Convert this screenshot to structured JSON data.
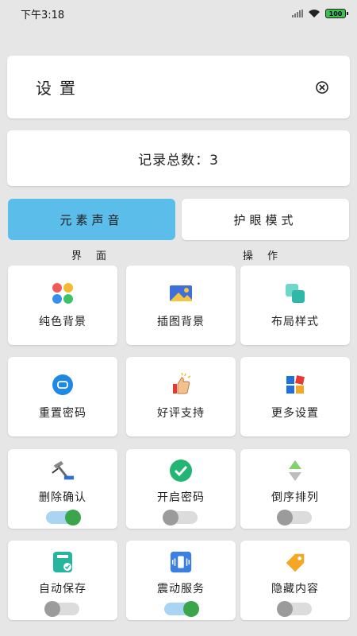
{
  "status": {
    "time": "下午3:18",
    "battery": "100"
  },
  "header": {
    "title": "设置",
    "close_icon": "close-circle-icon"
  },
  "summary": {
    "record_count_text": "记录总数：3"
  },
  "tabs": [
    {
      "label": "元素声音",
      "active": true
    },
    {
      "label": "护眼模式",
      "active": false
    }
  ],
  "sections": {
    "ui_label": "界面",
    "ops_label": "操作"
  },
  "tiles": [
    {
      "label": "纯色背景",
      "icon": "color-petals-icon"
    },
    {
      "label": "插图背景",
      "icon": "image-icon"
    },
    {
      "label": "布局样式",
      "icon": "layout-squares-icon"
    },
    {
      "label": "重置密码",
      "icon": "reset-password-icon"
    },
    {
      "label": "好评支持",
      "icon": "thumbs-up-icon"
    },
    {
      "label": "更多设置",
      "icon": "more-settings-icon"
    },
    {
      "label": "删除确认",
      "icon": "hammer-icon",
      "toggle": true
    },
    {
      "label": "开启密码",
      "icon": "check-circle-icon",
      "toggle": false
    },
    {
      "label": "倒序排列",
      "icon": "sort-arrows-icon",
      "toggle": false
    },
    {
      "label": "自动保存",
      "icon": "save-icon",
      "toggle": false
    },
    {
      "label": "震动服务",
      "icon": "vibrate-icon",
      "toggle": true
    },
    {
      "label": "隐藏内容",
      "icon": "tag-icon",
      "toggle": false
    }
  ],
  "colors": {
    "accent_blue": "#5bbde9",
    "toggle_on": "#3aa54a",
    "background": "#e6e6e6"
  }
}
